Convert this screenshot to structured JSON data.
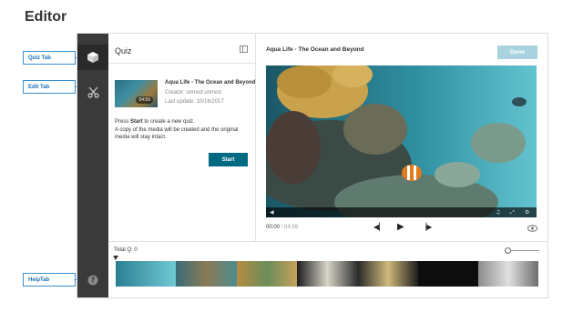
{
  "header": {
    "title": "Editor"
  },
  "callouts": [
    {
      "label": "Quiz Tab"
    },
    {
      "label": "Edit Tab"
    },
    {
      "label": "HelpTab"
    }
  ],
  "sidebar": {
    "items": [
      {
        "name": "quiz",
        "icon": "cube-icon"
      },
      {
        "name": "edit",
        "icon": "scissors-icon"
      },
      {
        "name": "help",
        "icon": "help-icon"
      }
    ]
  },
  "quiz_panel": {
    "title": "Quiz",
    "media": {
      "title": "Aqua Life - The Ocean and Beyond",
      "creator": "Creator: unmod unmod",
      "last_update": "Last update: 10/16/2017",
      "duration": "04:59"
    },
    "instructions": {
      "pre": "Press ",
      "bold": "Start",
      "post": " to create a new quiz.",
      "line2": "A copy of the media will be created and the original media will stay intact."
    },
    "start_label": "Start"
  },
  "player": {
    "title": "Aqua Life - The Ocean and Beyond",
    "done_label": "Done",
    "current_time": "00:00",
    "duration": " / 04:59"
  },
  "timeline": {
    "total_q": "Total Q: 0"
  },
  "colors": {
    "accent": "#006a83",
    "done_disabled": "#a9d3de",
    "sidebar": "#3a3a3a",
    "callout": "#3a8fd0"
  }
}
